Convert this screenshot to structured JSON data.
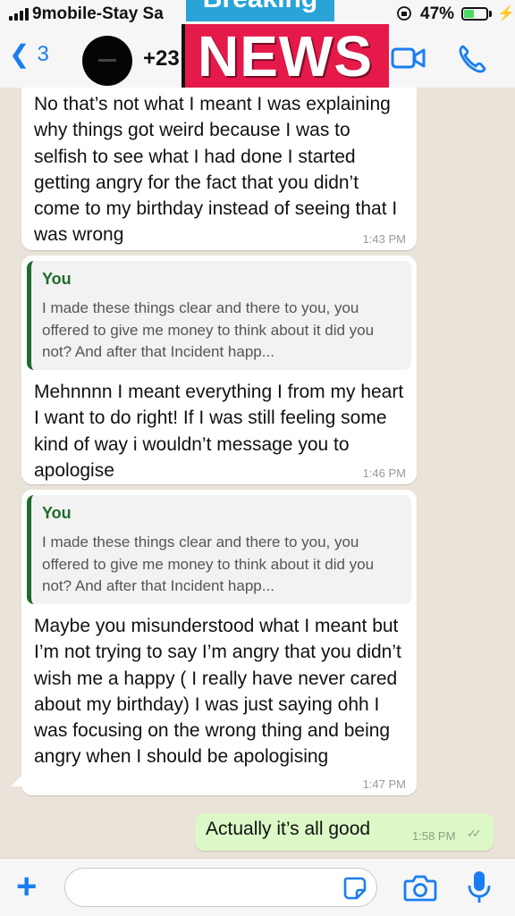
{
  "status_bar": {
    "carrier": "9mobile-Stay Sa",
    "battery": "47%",
    "battery_level": 0.47
  },
  "header": {
    "back_count": "3",
    "contact_name": "+23",
    "accent": "#1a7ef0"
  },
  "overlay": {
    "breaking": "Breaking",
    "news": "NEWS"
  },
  "messages": [
    {
      "text": "No that’s not what I meant I was explaining why things got weird because I was to selfish to see what I had done I started getting angry for the fact that you didn’t come to my birthday instead of seeing that I was wrong",
      "time": "1:43 PM"
    },
    {
      "quote_author": "You",
      "quote_text": "I made these things clear and there to you, you offered to give me money to think about it did you not? And after that Incident happ...",
      "text": "Mehnnnn I meant everything I from my heart I want to do right! If I was still feeling some kind of way i wouldn’t message you to apologise",
      "time": "1:46 PM"
    },
    {
      "quote_author": "You",
      "quote_text": "I made these things clear and there to you, you offered to give me money to think about it did you not? And after that Incident happ...",
      "text": "Maybe you misunderstood what I meant but I’m not trying to say I’m angry that you didn’t wish me a happy ( I really have never cared about my birthday) I was just saying ohh I was focusing on the wrong thing and being angry when I should be apologising",
      "time": "1:47 PM"
    }
  ],
  "outgoing": {
    "text": "Actually it’s all good",
    "time": "1:58 PM",
    "ticks": "✓✓"
  },
  "input": {
    "placeholder": ""
  },
  "icons": [
    "back-chevron-icon",
    "video-call-icon",
    "phone-icon",
    "plus-icon",
    "sticker-icon",
    "camera-icon",
    "microphone-icon"
  ]
}
